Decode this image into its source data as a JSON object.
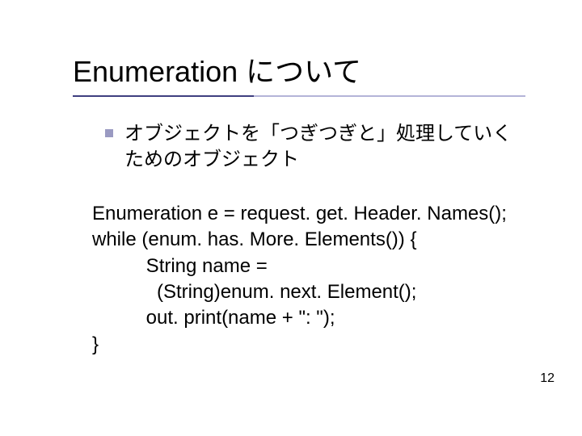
{
  "slide": {
    "title": "Enumeration について",
    "bullet": "オブジェクトを「つぎつぎと」処理していくためのオブジェクト",
    "code": {
      "l1": "Enumeration e = request. get. Header. Names();",
      "l2": "while (enum. has. More. Elements()) {",
      "l3": "          String name =",
      "l4": "            (String)enum. next. Element();",
      "l5": "          out. print(name + \": \");",
      "l6": "}"
    },
    "page_number": "12"
  }
}
